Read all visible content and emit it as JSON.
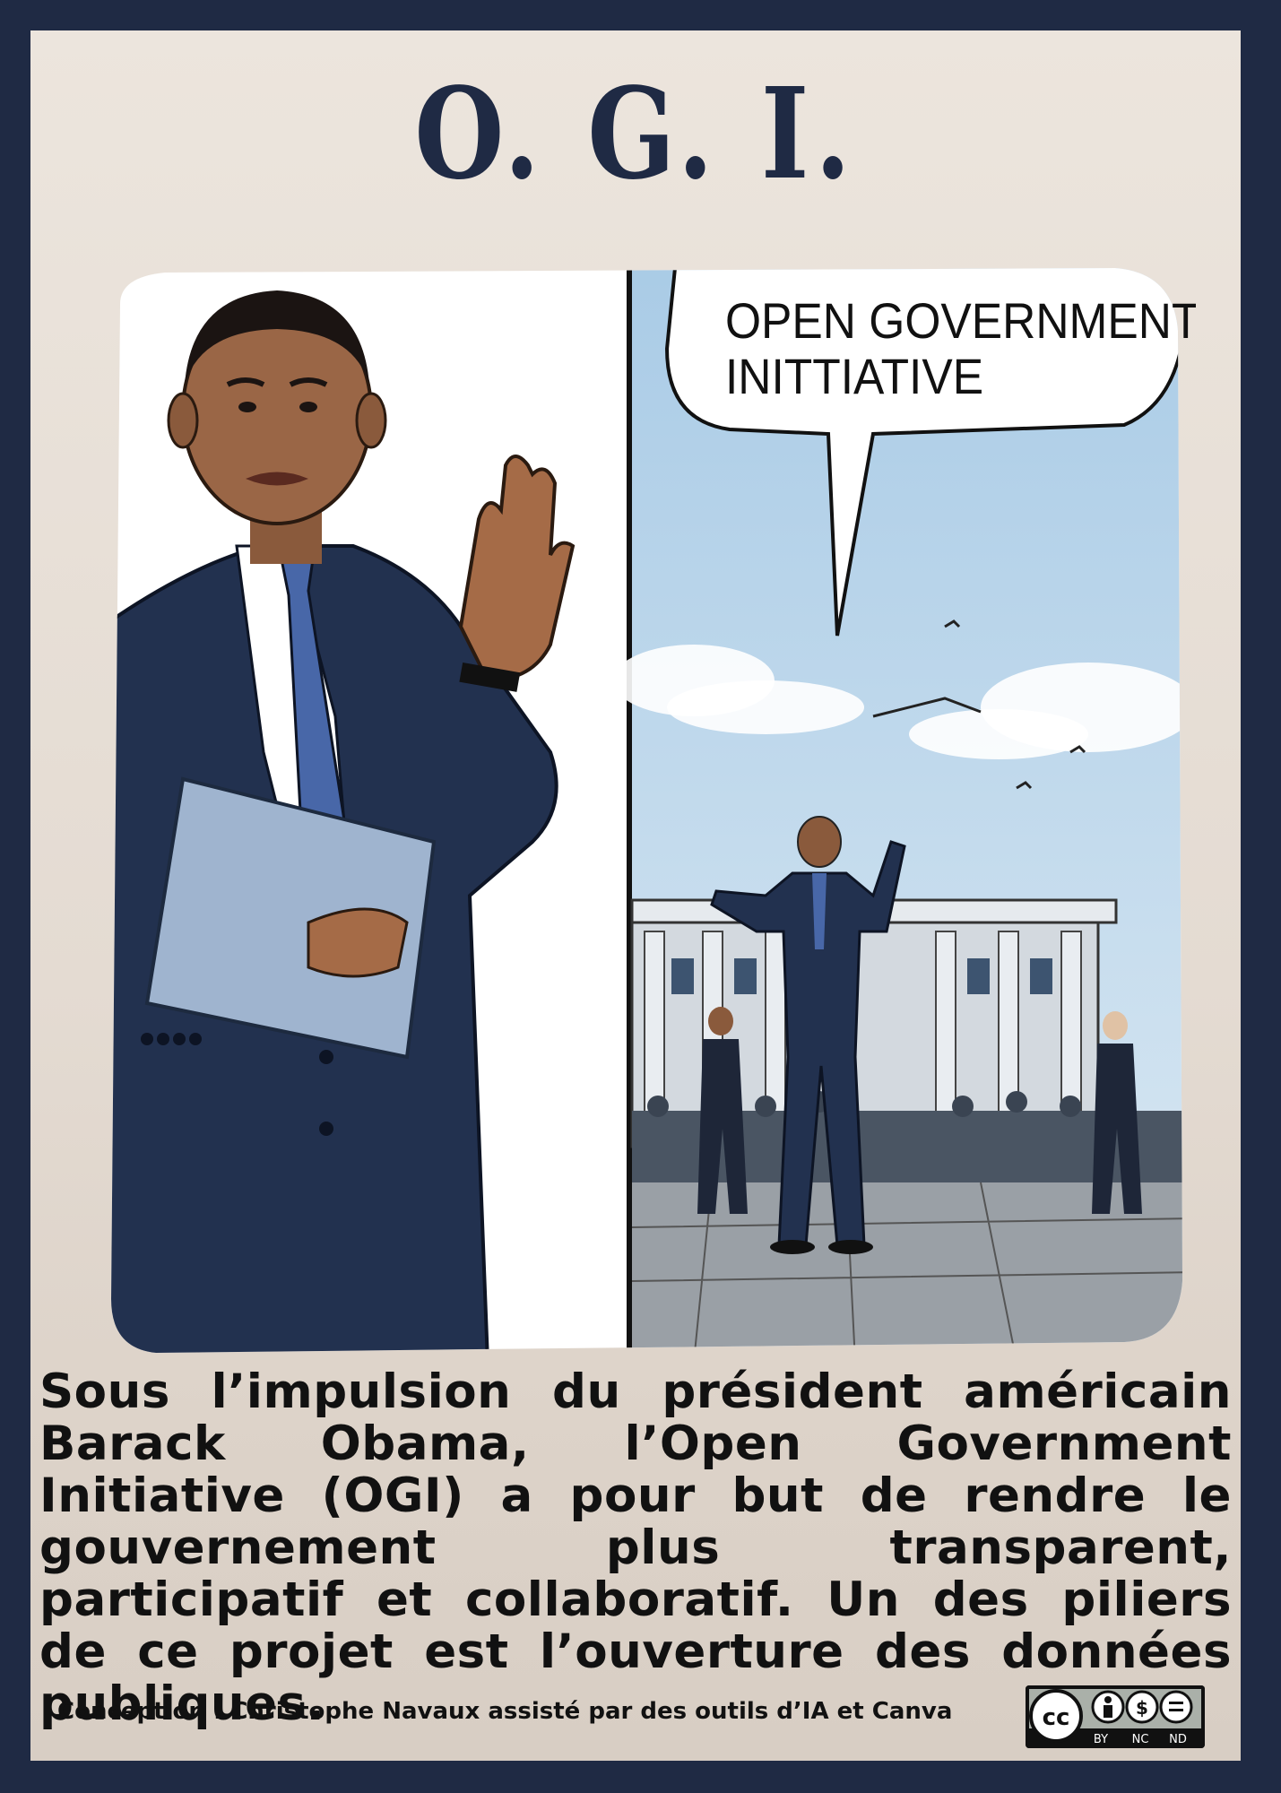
{
  "title": "O. G. I.",
  "speech_bubble": {
    "line1": "OPEN GOVERNMENT",
    "line2": "INITTIATIVE"
  },
  "caption": "Sous l’impulsion du président américain Barack Obama, l’Open Government Initiative (OGI) a pour but de rendre le gouvernement plus transparent, participatif et collaboratif. Un des piliers de ce projet est l’ouverture des données publiques.",
  "credit": "Conception : Christophe Navaux  assisté par des outils d’IA et Canva",
  "license": {
    "cc": "cc",
    "by": "BY",
    "nc": "NC",
    "nd": "ND"
  }
}
